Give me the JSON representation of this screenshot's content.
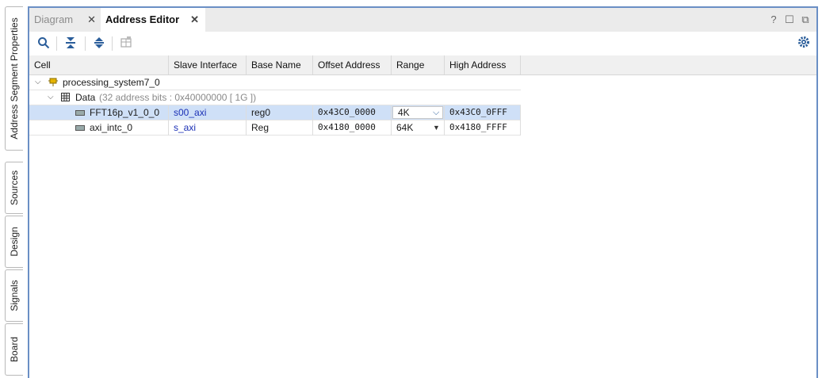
{
  "side_tabs": [
    {
      "label": "Address Segment Properties"
    },
    {
      "label": "Sources"
    },
    {
      "label": "Design"
    },
    {
      "label": "Signals"
    },
    {
      "label": "Board"
    }
  ],
  "tabs": [
    {
      "label": "Diagram",
      "close": "✕"
    },
    {
      "label": "Address Editor",
      "close": "✕"
    }
  ],
  "window_controls": {
    "help": "?",
    "restore": "☐",
    "float": "⧉"
  },
  "toolbar": {
    "search": "🔍",
    "collapse": "⯯",
    "expand": "⬍",
    "assign": "▦",
    "settings": "⚙"
  },
  "columns": [
    "Cell",
    "Slave Interface",
    "Base Name",
    "Offset Address",
    "Range",
    "High Address"
  ],
  "tree": {
    "root": "processing_system7_0",
    "group": "Data",
    "group_detail": "(32 address bits : 0x40000000 [ 1G ])",
    "rows": [
      {
        "cell": "FFT16p_v1_0_0",
        "slave": "s00_axi",
        "base": "reg0",
        "offset": "0x43C0_0000",
        "range": "4K",
        "high": "0x43C0_0FFF"
      },
      {
        "cell": "axi_intc_0",
        "slave": "s_axi",
        "base": "Reg",
        "offset": "0x4180_0000",
        "range": "64K",
        "high": "0x4180_FFFF"
      }
    ]
  },
  "colors": {
    "accent": "#6a8fc5",
    "selection": "#cfe0f7",
    "link": "#1a2fb5"
  }
}
